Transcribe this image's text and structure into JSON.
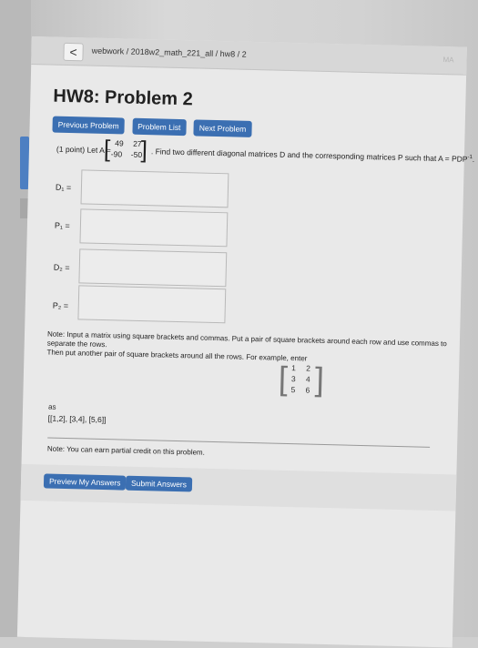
{
  "header": {
    "back_label": "<",
    "breadcrumb": "webwork / 2018w2_math_221_all / hw8 / 2",
    "logo": "MA"
  },
  "title": "HW8: Problem 2",
  "nav": {
    "prev": "Previous Problem",
    "list": "Problem List",
    "next": "Next Problem"
  },
  "problem": {
    "prefix": "(1 point) Let A =",
    "matrix": {
      "a11": "49",
      "a12": "27",
      "a21": "-90",
      "a22": "-50"
    },
    "suffix": ". Find two different diagonal matrices D and the corresponding matrices P such that A = PDP",
    "sup": "-1",
    "period": "."
  },
  "fields": [
    {
      "label": "D₁ ="
    },
    {
      "label": "P₁ ="
    },
    {
      "label": "D₂ ="
    },
    {
      "label": "P₂ ="
    }
  ],
  "note1": {
    "line1": "Note: Input a matrix using square brackets and commas. Put a pair of square brackets around each row and use commas to separate the rows.",
    "line2": "Then put another pair of square brackets around all the rows. For example, enter"
  },
  "example_matrix": {
    "r1c1": "1",
    "r1c2": "2",
    "r2c1": "3",
    "r2c2": "4",
    "r3c1": "5",
    "r3c2": "6"
  },
  "as_label": "as",
  "example_text": "[[1,2], [3,4], [5,6]]",
  "note2": "Note: You can earn partial credit on this problem.",
  "bottom": {
    "preview": "Preview My Answers",
    "submit": "Submit Answers"
  }
}
